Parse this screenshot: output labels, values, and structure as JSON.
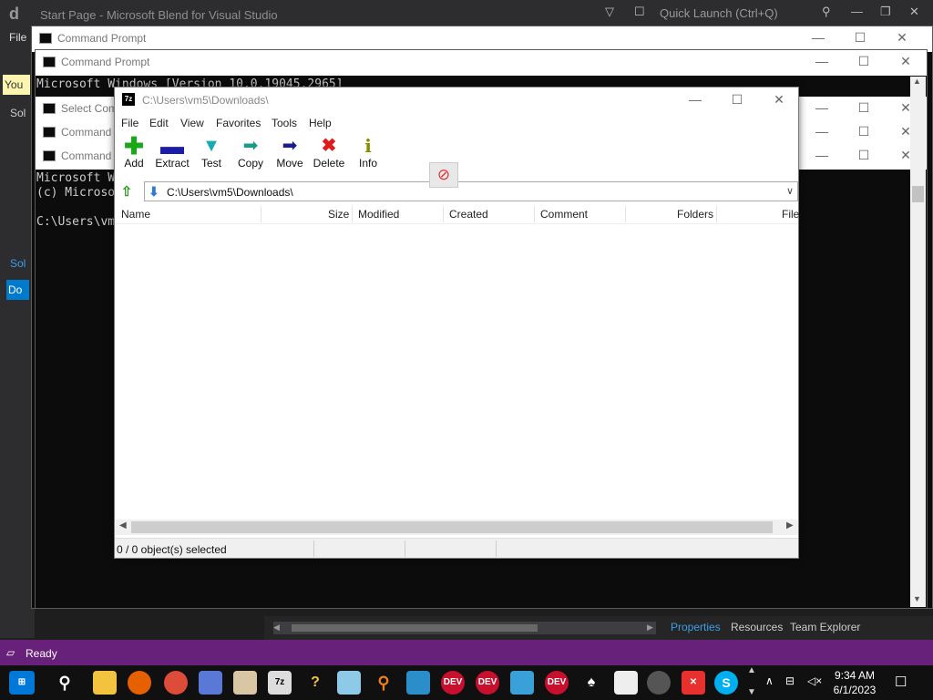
{
  "blend": {
    "title": "Start Page - Microsoft Blend for Visual Studio",
    "quick_launch": "Quick Launch (Ctrl+Q)",
    "menu_file": "File",
    "tip_text": "You",
    "sol1": "Sol",
    "sol2": "Sol",
    "doc_tab": "Do",
    "bottom_tabs": [
      "Properties",
      "Resources",
      "Team Explorer"
    ],
    "status": "Ready",
    "accent": "#68217a"
  },
  "cmd_windows": [
    {
      "title": "Command Prompt"
    },
    {
      "title": "Command Prompt"
    },
    {
      "title": "Select Com"
    },
    {
      "title": "Command"
    },
    {
      "title": "Command"
    }
  ],
  "cmd_text": {
    "version_line": "Microsoft Windows [Version 10.0.19045.2965]",
    "lines": [
      "Microsoft W",
      "(c) Microso",
      "",
      "C:\\Users\\vm"
    ]
  },
  "sevenzip": {
    "title": "C:\\Users\\vm5\\Downloads\\",
    "menu": [
      "File",
      "Edit",
      "View",
      "Favorites",
      "Tools",
      "Help"
    ],
    "tools": [
      {
        "label": "Add",
        "icon": "add-icon"
      },
      {
        "label": "Extract",
        "icon": "extract-icon"
      },
      {
        "label": "Test",
        "icon": "test-icon"
      },
      {
        "label": "Copy",
        "icon": "copy-icon"
      },
      {
        "label": "Move",
        "icon": "move-icon"
      },
      {
        "label": "Delete",
        "icon": "delete-icon"
      },
      {
        "label": "Info",
        "icon": "info-icon"
      }
    ],
    "address": "C:\\Users\\vm5\\Downloads\\",
    "columns": [
      "Name",
      "Size",
      "Modified",
      "Created",
      "Comment",
      "Folders",
      "File"
    ],
    "status": "0 / 0 object(s) selected"
  },
  "taskbar": {
    "time": "9:34 AM",
    "date": "6/1/2023",
    "apps": [
      "start",
      "search",
      "file-explorer",
      "firefox",
      "chrome",
      "app",
      "archive",
      "7zip",
      "help",
      "notepad",
      "search-tool",
      "blend",
      "devcpp",
      "devcpp",
      "vscode-like",
      "devcpp",
      "solitaire",
      "window",
      "media",
      "close-app",
      "skype"
    ]
  }
}
